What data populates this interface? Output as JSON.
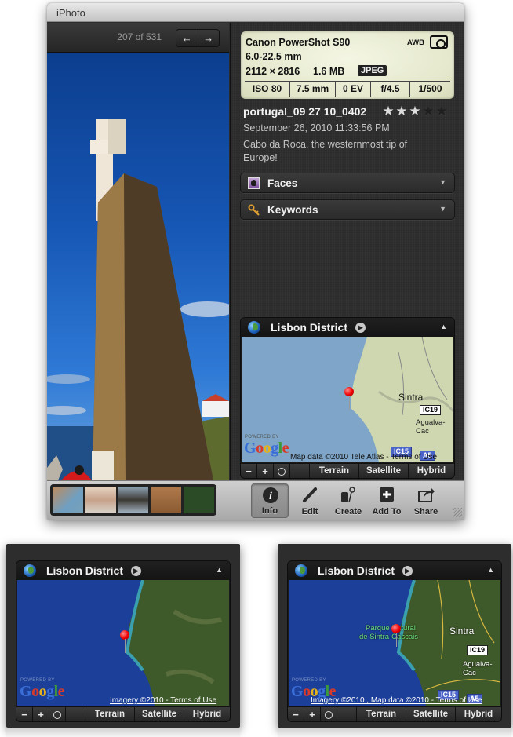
{
  "window": {
    "title": "iPhoto"
  },
  "viewer": {
    "counter": "207 of 531",
    "prev_icon": "arrow-left-icon",
    "next_icon": "arrow-right-icon",
    "prev_glyph": "←",
    "next_glyph": "→"
  },
  "exif": {
    "camera": "Canon PowerShot S90",
    "white_balance": "AWB",
    "metering_icon": "metering-icon",
    "lens": "6.0-22.5 mm",
    "dimensions": "2112 × 2816",
    "file_size": "1.6 MB",
    "format": "JPEG",
    "settings": [
      "ISO 80",
      "7.5 mm",
      "0 EV",
      "f/4.5",
      "1/500"
    ]
  },
  "photo": {
    "filename": "portugal_09 27 10_0402",
    "rating": 3,
    "rating_max": 5,
    "star_glyph": "★",
    "datetime": "September 26, 2010 11:33:56 PM",
    "caption": "Cabo da Roca, the westernmost tip of Europe!"
  },
  "sections": {
    "faces": {
      "label": "Faces",
      "arrow": "▼"
    },
    "keywords": {
      "label": "Keywords",
      "arrow": "▼"
    }
  },
  "maps": [
    {
      "title": "Lisbon District",
      "go_glyph": "▶",
      "collapse_glyph": "▲",
      "mode": "Terrain",
      "powered_by": "POWERED BY",
      "attribution": "Map data ©2010 Tele Atlas - Terms of Use",
      "places": [
        "Sintra",
        "Agualva-Cac"
      ],
      "roads": [
        "IC19",
        "IC15",
        "A5"
      ]
    },
    {
      "title": "Lisbon District",
      "go_glyph": "▶",
      "collapse_glyph": "▲",
      "mode": "Satellite",
      "powered_by": "POWERED BY",
      "attribution": "Imagery ©2010 - Terms of Use",
      "places": [],
      "roads": []
    },
    {
      "title": "Lisbon District",
      "go_glyph": "▶",
      "collapse_glyph": "▲",
      "mode": "Hybrid",
      "powered_by": "POWERED BY",
      "attribution": "Imagery ©2010 , Map data ©2010 - Terms of Use",
      "places": [
        "Parque Natural",
        "de Sintra-Cascais",
        "Sintra",
        "Agualva-Cac"
      ],
      "roads": [
        "IC19",
        "IC15",
        "A5"
      ]
    }
  ],
  "map_toolbar": {
    "zoom_out": "−",
    "zoom_in": "+",
    "terrain": "Terrain",
    "satellite": "Satellite",
    "hybrid": "Hybrid"
  },
  "google": {
    "letters": [
      "G",
      "o",
      "o",
      "g",
      "l",
      "e"
    ]
  },
  "toolbar": {
    "info": "Info",
    "edit": "Edit",
    "create": "Create",
    "add_to": "Add To",
    "share": "Share",
    "active": "Info"
  },
  "filmstrip": {
    "thumb_count": 5
  },
  "colors": {
    "exif_bg": "#e5e8cc",
    "panel_bg": "#2e2e2e",
    "pin": "#e00000",
    "ocean_terrain": "#7fa6c8",
    "ocean_satellite": "#1c3f9a",
    "land_terrain": "#cfd7b0",
    "land_satellite": "#3f5a2a"
  }
}
